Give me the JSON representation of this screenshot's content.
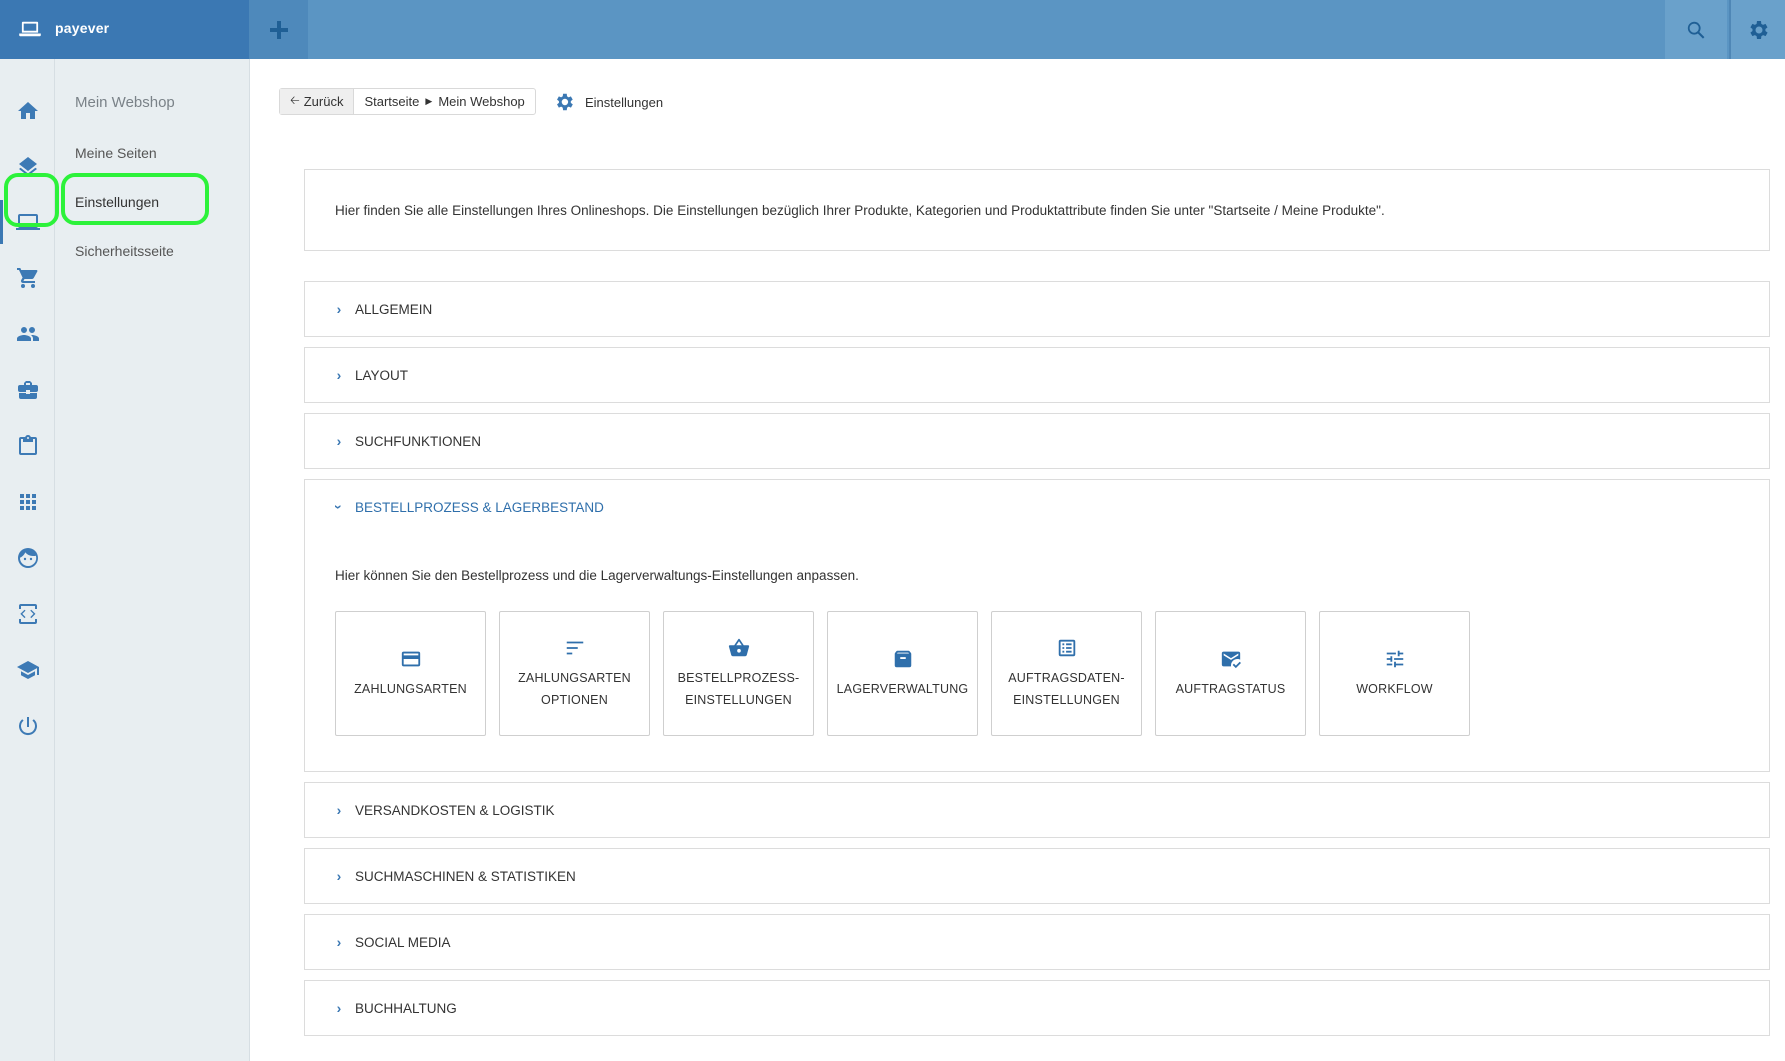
{
  "topbar": {
    "brand_name": "payever",
    "brand_icon": "laptop-icon",
    "add_icon": "plus-icon",
    "search_icon": "search-icon",
    "settings_icon": "gear-icon",
    "colors": {
      "bar": "#5b95c3",
      "brand": "#3b78b3",
      "highlight": "#2cf23a"
    }
  },
  "rail": {
    "items": [
      {
        "icon": "home-icon"
      },
      {
        "icon": "layers-icon"
      },
      {
        "icon": "laptop-icon",
        "active": true
      },
      {
        "icon": "cart-icon"
      },
      {
        "icon": "people-icon"
      },
      {
        "icon": "briefcase-icon"
      },
      {
        "icon": "clipboard-icon"
      },
      {
        "icon": "apps-grid-icon"
      },
      {
        "icon": "face-icon"
      },
      {
        "icon": "code-icon"
      },
      {
        "icon": "school-icon"
      },
      {
        "icon": "power-icon"
      }
    ]
  },
  "submenu": {
    "title": "Mein Webshop",
    "items": [
      {
        "label": "Meine Seiten"
      },
      {
        "label": "Einstellungen",
        "active": true
      },
      {
        "label": "Sicherheitsseite"
      }
    ]
  },
  "breadcrumb": {
    "back_label": "Zurück",
    "items": [
      "Startseite",
      "Mein Webshop"
    ],
    "current": "Einstellungen"
  },
  "intro_text": "Hier finden Sie alle Einstellungen Ihres Onlineshops. Die Einstellungen bezüglich Ihrer Produkte, Kategorien und Produktattribute finden Sie unter \"Startseite / Meine Produkte\".",
  "sections": [
    {
      "label": "ALLGEMEIN",
      "open": false
    },
    {
      "label": "LAYOUT",
      "open": false
    },
    {
      "label": "SUCHFUNKTIONEN",
      "open": false
    },
    {
      "label": "BESTELLPROZESS & LAGERBESTAND",
      "open": true
    },
    {
      "label": "VERSANDKOSTEN & LOGISTIK",
      "open": false
    },
    {
      "label": "SUCHMASCHINEN & STATISTIKEN",
      "open": false
    },
    {
      "label": "SOCIAL MEDIA",
      "open": false
    },
    {
      "label": "BUCHHALTUNG",
      "open": false
    }
  ],
  "open_section": {
    "description": "Hier können Sie den Bestellprozess und die Lagerverwaltungs-Einstellungen anpassen.",
    "tiles": [
      {
        "line1": "ZAHLUNGSARTEN",
        "line2": "",
        "icon": "credit-card-icon"
      },
      {
        "line1": "ZAHLUNGSARTEN",
        "line2": "OPTIONEN",
        "icon": "sort-lines-icon"
      },
      {
        "line1": "BESTELLPROZESS-",
        "line2": "EINSTELLUNGEN",
        "icon": "basket-icon"
      },
      {
        "line1": "LAGERVERWALTUNG",
        "line2": "",
        "icon": "archive-box-icon"
      },
      {
        "line1": "AUFTRAGSDATEN-",
        "line2": "EINSTELLUNGEN",
        "icon": "list-document-icon"
      },
      {
        "line1": "AUFTRAGSTATUS",
        "line2": "",
        "icon": "mark-email-read-icon"
      },
      {
        "line1": "WORKFLOW",
        "line2": "",
        "icon": "tune-sliders-icon"
      }
    ]
  }
}
